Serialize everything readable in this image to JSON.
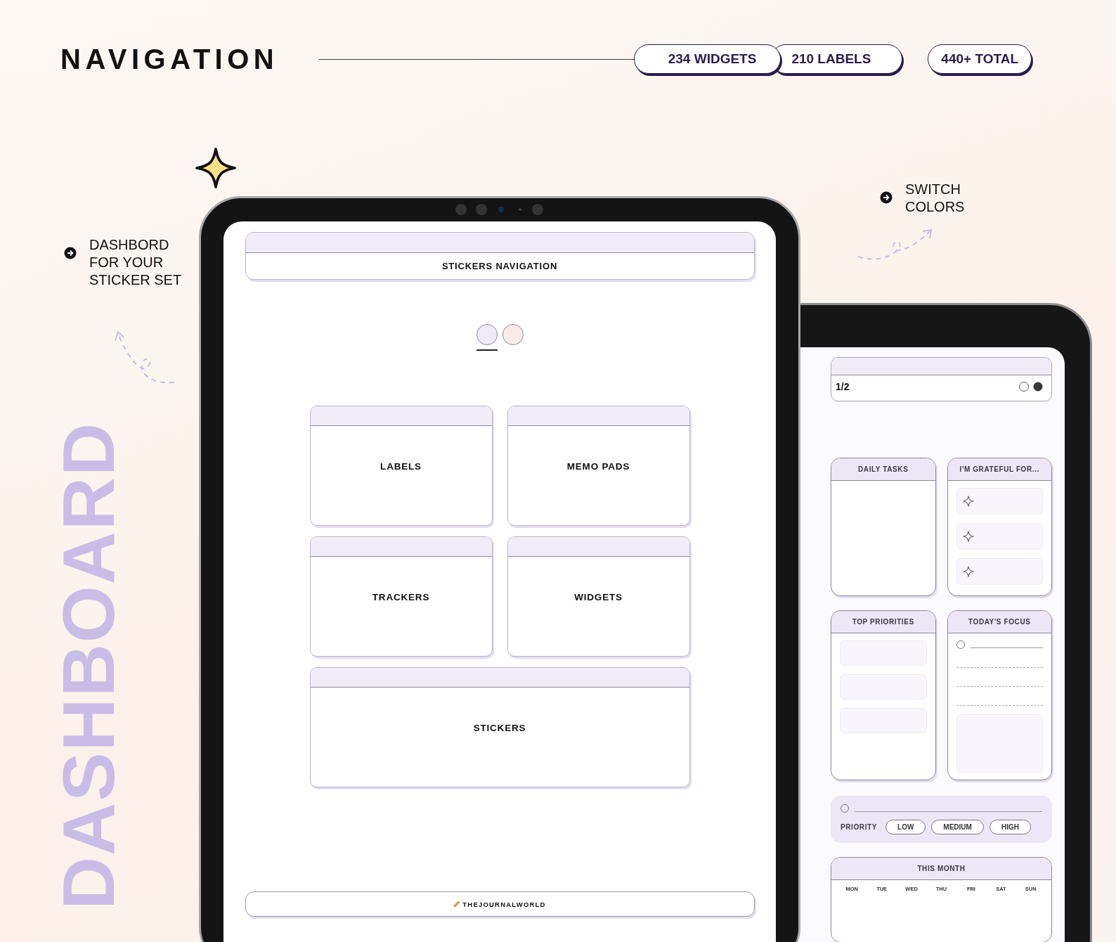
{
  "title": "NAVIGATION",
  "count_group": [
    "234 WIDGETS",
    "210 LABELS"
  ],
  "total": "440+ TOTAL",
  "left_note": "DASHBORD\nFOR YOUR\nSTICKER SET",
  "right_note": "SWITCH\nCOLORS",
  "background_word": "DASHBOARD",
  "tablet": {
    "header": "STICKERS NAVIGATION",
    "swatches": [
      {
        "color": "#efe9f7",
        "selected": true
      },
      {
        "color": "#f9ece8",
        "selected": false
      }
    ],
    "sections": [
      {
        "label": "LABELS",
        "wide": false
      },
      {
        "label": "MEMO PADS",
        "wide": false
      },
      {
        "label": "TRACKERS",
        "wide": false
      },
      {
        "label": "WIDGETS",
        "wide": false
      },
      {
        "label": "STICKERS",
        "wide": true
      }
    ],
    "footer": "THEJOURNALWORLD"
  },
  "second_tablet": {
    "page": "1/2",
    "cards": [
      {
        "kind": "plain",
        "title": "DAILY TASKS"
      },
      {
        "kind": "grateful",
        "title": "I'M GRATEFUL FOR..."
      },
      {
        "kind": "fields",
        "title": "TOP PRIORITIES"
      },
      {
        "kind": "focus",
        "title": "TODAY'S FOCUS"
      }
    ],
    "priority": {
      "label": "PRIORITY",
      "options": [
        "LOW",
        "MEDIUM",
        "HIGH"
      ]
    },
    "month": {
      "title": "THIS MONTH",
      "weekdays": [
        "MON",
        "TUE",
        "WED",
        "THU",
        "FRI",
        "SAT",
        "SUN"
      ]
    }
  }
}
